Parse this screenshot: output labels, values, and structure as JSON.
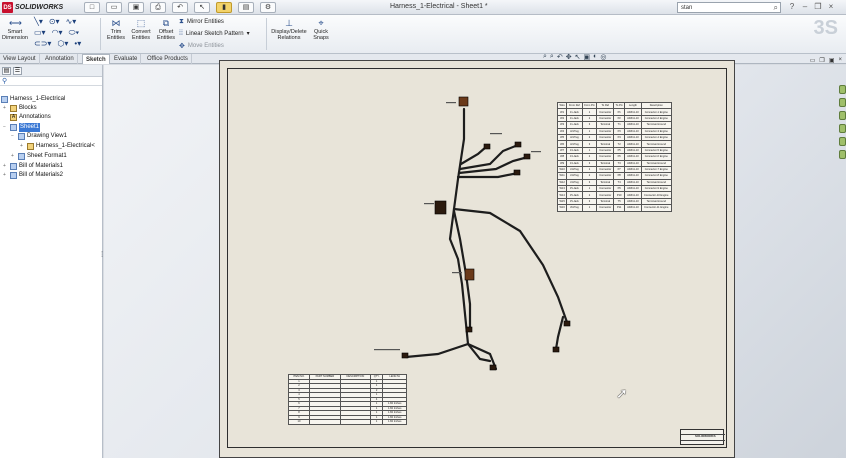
{
  "titlebar": {
    "app_name": "SOLIDWORKS",
    "ds_mark": "DS",
    "doc_title": "Harness_1-Electrical - Sheet1 *",
    "search_text": "stan",
    "qat_icons": [
      "new-icon",
      "open-icon",
      "save-icon",
      "print-icon",
      "undo-icon",
      "select-icon",
      "rebuild-icon",
      "file-properties-icon",
      "options-icon"
    ]
  },
  "command_manager": {
    "smart_dimension": "Smart Dimension",
    "trim_entities": "Trim Entities",
    "convert_entities": "Convert Entities",
    "offset_entities": "Offset Entities",
    "mirror_entities": "Mirror Entities",
    "linear_sketch_pattern": "Linear Sketch Pattern",
    "move_entities": "Move Entities",
    "display_delete_relations": "Display/Delete Relations",
    "quick_snaps": "Quick Snaps"
  },
  "tabs": [
    "View Layout",
    "Annotation",
    "Sketch",
    "Evaluate",
    "Office Products"
  ],
  "active_tab": "Sketch",
  "tree": {
    "root": "Harness_1-Electrical",
    "blocks": "Blocks",
    "annotations": "Annotations",
    "sheet": "Sheet1",
    "drawing_view": "Drawing View1",
    "view_ref": "Harness_1-Electrical<",
    "sheet_format": "Sheet Format1",
    "bom1": "Bill of Materials1",
    "bom2": "Bill of Materials2"
  },
  "right_table": {
    "header": [
      "Wire",
      "From Ref",
      "From Pin",
      "To Ref",
      "To Pin",
      "Length",
      "Description"
    ],
    "rows": [
      [
        "W1",
        "J1-Jack",
        "1",
        "Connector",
        "P1",
        "ADZ11-10",
        "Connector-1 Engine"
      ],
      [
        "W2",
        "J1-Jack",
        "2",
        "Connector",
        "P2",
        "ADZ11-10",
        "Connector-2 Engine"
      ],
      [
        "W3",
        "J1-Jack",
        "3",
        "Terminal",
        "T1",
        "ADZ11-10",
        "Terminal-Ground"
      ],
      [
        "W4",
        "J2-Plug",
        "1",
        "Connector",
        "P3",
        "ADZ11-10",
        "Connector-3 Engine"
      ],
      [
        "W5",
        "J2-Plug",
        "2",
        "Connector",
        "P4",
        "ADZ11-10",
        "Connector-4 Engine"
      ],
      [
        "W6",
        "J2-Plug",
        "3",
        "Terminal",
        "T2",
        "ADZ11-10",
        "Terminal-Ground"
      ],
      [
        "W7",
        "J3-Jack",
        "1",
        "Connector",
        "P5",
        "ADZ11-10",
        "Connector-5 Engine"
      ],
      [
        "W8",
        "J3-Jack",
        "2",
        "Connector",
        "P6",
        "ADZ11-10",
        "Connector-6 Engine"
      ],
      [
        "W9",
        "J3-Jack",
        "3",
        "Terminal",
        "T3",
        "ADZ11-10",
        "Terminal-Ground"
      ],
      [
        "W10",
        "J4-Plug",
        "1",
        "Connector",
        "P7",
        "ADZ11-10",
        "Connector-7 Engine"
      ],
      [
        "W11",
        "J4-Plug",
        "2",
        "Connector",
        "P8",
        "ADZ11-10",
        "Connector-8 Engine"
      ],
      [
        "W12",
        "J4-Plug",
        "3",
        "Terminal",
        "T4",
        "ADZ11-10",
        "Terminal-Ground"
      ],
      [
        "W13",
        "J5-Jack",
        "1",
        "Connector",
        "P9",
        "ADZ11-10",
        "Connector-9 Engine"
      ],
      [
        "W14",
        "J5-Jack",
        "2",
        "Connector",
        "P10",
        "ADZ11-10",
        "Connector-10 Engine"
      ],
      [
        "W15",
        "J5-Jack",
        "3",
        "Terminal",
        "T5",
        "ADZ11-10",
        "Terminal-Ground"
      ],
      [
        "W16",
        "J6-Plug",
        "1",
        "Connector",
        "P11",
        "ADZ11-10",
        "Connector-11 Engine"
      ]
    ]
  },
  "bom_table": {
    "header": [
      "ITEM NO.",
      "PART NUMBER",
      "DESCRIPTION",
      "QTY.",
      "LENGTH"
    ],
    "rows": [
      [
        "1",
        "",
        "",
        "1",
        ""
      ],
      [
        "2",
        "",
        "",
        "1",
        ""
      ],
      [
        "3",
        "",
        "",
        "2",
        ""
      ],
      [
        "4",
        "",
        "",
        "1",
        ""
      ],
      [
        "5",
        "",
        "",
        "4",
        ""
      ],
      [
        "6",
        "",
        "",
        "1",
        "1.84 Inches"
      ],
      [
        "7",
        "",
        "",
        "1",
        "1.84 Inches"
      ],
      [
        "8",
        "",
        "",
        "1",
        "1.84 Inches"
      ],
      [
        "9",
        "",
        "",
        "1",
        "1.84 Inches"
      ],
      [
        "10",
        "",
        "",
        "1",
        "1.84 Inches"
      ]
    ]
  },
  "title_block": {
    "logo_text": "SOLIDWORKS"
  }
}
